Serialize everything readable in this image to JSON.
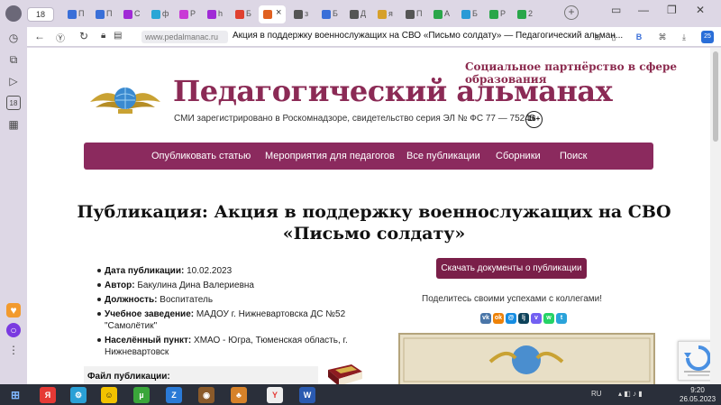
{
  "browser": {
    "profile_count": "18",
    "tabs": [
      {
        "label": "П",
        "color": "#3a6fd8"
      },
      {
        "label": "П",
        "color": "#3a6fd8"
      },
      {
        "label": "С",
        "color": "#a02ad6"
      },
      {
        "label": "ф",
        "color": "#2aa6d6"
      },
      {
        "label": "Р",
        "color": "#c93ad6"
      },
      {
        "label": "h",
        "color": "#a02ad6"
      },
      {
        "label": "Б",
        "color": "#e04030"
      },
      {
        "label": "",
        "color": "#e06020",
        "active": true
      },
      {
        "label": "з",
        "color": "#555555"
      },
      {
        "label": "Б",
        "color": "#3a6fd8"
      },
      {
        "label": "Д",
        "color": "#555555"
      },
      {
        "label": "я",
        "color": "#d6a02a"
      },
      {
        "label": "П",
        "color": "#555555"
      },
      {
        "label": "А",
        "color": "#2aa64a"
      },
      {
        "label": "Б",
        "color": "#2a9ad6"
      },
      {
        "label": "Р",
        "color": "#2aa64a"
      },
      {
        "label": "2",
        "color": "#2aa64a"
      }
    ],
    "domain": "www.pedalmanac.ru",
    "page_title": "Акция в поддержку военнослужащих на СВО «Письмо солдату» — Педагогический альман...",
    "badge_count": "25"
  },
  "page": {
    "partner": "Социальное партнёрство в сфере образования",
    "site_title": "Педагогический альманах",
    "registration": "СМИ зарегистрировано в Роскомнадзоре, свидетельство серия ЭЛ № ФС 77 — 75245",
    "age_rating": "16+",
    "menu": [
      "Опубликовать статью",
      "Мероприятия для педагогов",
      "Все публикации",
      "Сборники",
      "Поиск"
    ],
    "publication_title": "Публикация: Акция в поддержку военнослужащих на СВО «Письмо солдату»",
    "info": {
      "date_label": "Дата публикации:",
      "date": "10.02.2023",
      "author_label": "Автор:",
      "author": "Бакулина Дина Валериевна",
      "position_label": "Должность:",
      "position": "Воспитатель",
      "school_label": "Учебное заведение:",
      "school": "МАДОУ г. Нижневартовска ДС №52 \"Самолётик\"",
      "place_label": "Населённый пункт:",
      "place": "ХМАО - Югра, Тюменская область, г. Нижневартовск"
    },
    "download_button": "Скачать документы о публикации",
    "share_text": "Поделитесь своими успехами с коллегами!",
    "share_buttons": [
      {
        "name": "vk",
        "label": "vk",
        "color": "#4a76a8"
      },
      {
        "name": "ok",
        "label": "ok",
        "color": "#ee8208"
      },
      {
        "name": "mailru",
        "label": "@",
        "color": "#168de2"
      },
      {
        "name": "livejournal",
        "label": "lj",
        "color": "#0d425a"
      },
      {
        "name": "viber",
        "label": "v",
        "color": "#7360f2"
      },
      {
        "name": "whatsapp",
        "label": "w",
        "color": "#25d366"
      },
      {
        "name": "telegram",
        "label": "t",
        "color": "#2aa3da"
      }
    ],
    "file_label": "Файл публикации:"
  },
  "taskbar": {
    "lang": "RU",
    "time": "9:20",
    "date": "26.05.2023"
  },
  "colors": {
    "brand": "#8b2a5e",
    "button": "#7a1f49"
  }
}
